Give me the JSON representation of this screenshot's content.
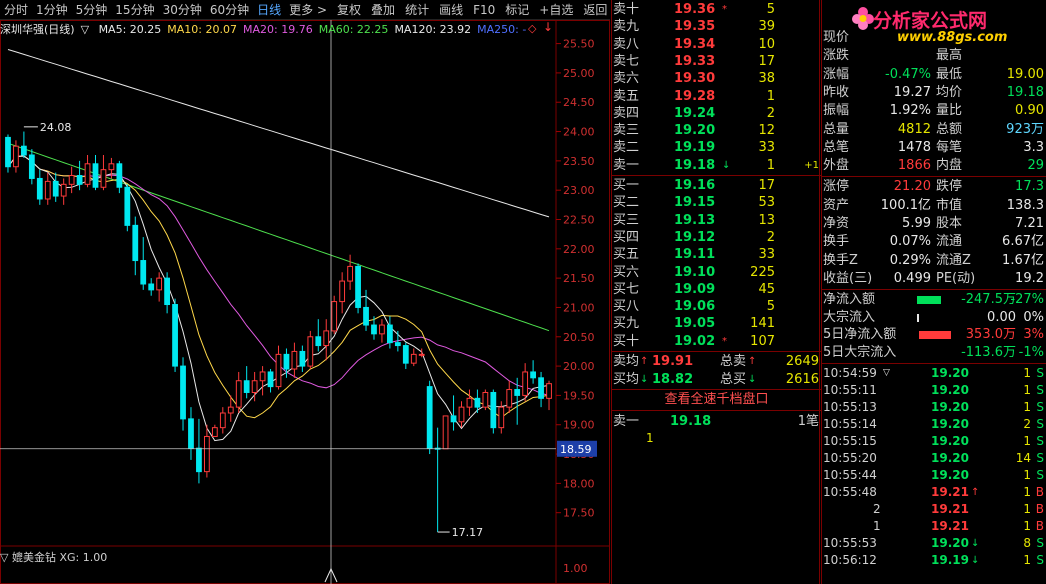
{
  "toolbar": {
    "periods": [
      "分时",
      "1分钟",
      "5分钟",
      "15分钟",
      "30分钟",
      "60分钟",
      "日线",
      "更多 >"
    ],
    "active": "日线",
    "actions": [
      "复权",
      "叠加",
      "统计",
      "画线",
      "F10",
      "标记",
      "+自选",
      "返回"
    ]
  },
  "chart": {
    "title": "深圳华强(日线)",
    "legend_marker": "▽",
    "ma": [
      {
        "label": "MA5: 20.25",
        "color": "#e8e8e8"
      },
      {
        "label": "MA10: 20.07",
        "color": "#ffd84a"
      },
      {
        "label": "MA20: 19.76",
        "color": "#e05ae0"
      },
      {
        "label": "MA60: 22.25",
        "color": "#4ee04e"
      },
      {
        "label": "MA120: 23.92",
        "color": "#e8e8e8"
      },
      {
        "label": "MA250: -",
        "color": "#4f6fff"
      }
    ],
    "marks": {
      "high_label": "24.08",
      "low_label": "17.17",
      "current_price": "18.59"
    },
    "sub_indicator": "▽ 媲美金钻  XG: 1.00",
    "sub_axis_label": "1.00",
    "up_color": "#ff3b3b",
    "down_color": "#00e8f0"
  },
  "chart_data": {
    "type": "candlestick",
    "ylim": [
      17.0,
      25.8
    ],
    "yticks": [
      "25.50",
      "25.00",
      "24.50",
      "24.00",
      "23.50",
      "23.00",
      "22.50",
      "22.00",
      "21.50",
      "21.00",
      "20.50",
      "20.00",
      "19.50",
      "19.00",
      "18.50",
      "18.00",
      "17.50"
    ],
    "candles": [
      [
        23.9,
        23.95,
        23.3,
        23.4
      ],
      [
        23.4,
        23.85,
        23.3,
        23.75
      ],
      [
        23.75,
        24.0,
        23.55,
        23.6
      ],
      [
        23.6,
        23.7,
        23.1,
        23.2
      ],
      [
        23.2,
        23.35,
        22.75,
        22.85
      ],
      [
        22.85,
        23.3,
        22.75,
        23.15
      ],
      [
        23.15,
        23.3,
        22.8,
        22.9
      ],
      [
        22.9,
        23.2,
        22.75,
        23.1
      ],
      [
        23.1,
        23.4,
        22.95,
        23.25
      ],
      [
        23.25,
        23.5,
        23.0,
        23.1
      ],
      [
        23.1,
        23.6,
        23.05,
        23.45
      ],
      [
        23.45,
        23.6,
        23.0,
        23.05
      ],
      [
        23.05,
        23.6,
        23.0,
        23.35
      ],
      [
        23.35,
        23.55,
        23.2,
        23.45
      ],
      [
        23.45,
        23.5,
        22.95,
        23.05
      ],
      [
        23.05,
        23.1,
        22.3,
        22.4
      ],
      [
        22.4,
        22.55,
        21.55,
        21.8
      ],
      [
        21.8,
        22.2,
        21.3,
        21.4
      ],
      [
        21.4,
        21.5,
        21.2,
        21.3
      ],
      [
        21.3,
        21.6,
        21.1,
        21.5
      ],
      [
        21.5,
        21.6,
        20.9,
        21.05
      ],
      [
        21.05,
        21.15,
        19.9,
        20.0
      ],
      [
        20.0,
        20.15,
        18.9,
        19.1
      ],
      [
        19.1,
        19.3,
        18.4,
        18.6
      ],
      [
        18.6,
        19.1,
        18.0,
        18.2
      ],
      [
        18.2,
        19.0,
        18.1,
        18.8
      ],
      [
        18.8,
        19.0,
        18.8,
        18.95
      ],
      [
        18.95,
        19.3,
        18.85,
        19.2
      ],
      [
        19.2,
        19.5,
        19.05,
        19.3
      ],
      [
        19.3,
        19.9,
        19.2,
        19.75
      ],
      [
        19.75,
        20.0,
        19.45,
        19.55
      ],
      [
        19.55,
        19.9,
        19.4,
        19.75
      ],
      [
        19.75,
        20.0,
        19.5,
        19.9
      ],
      [
        19.9,
        19.95,
        19.55,
        19.65
      ],
      [
        19.65,
        20.35,
        19.6,
        20.2
      ],
      [
        20.2,
        20.3,
        19.8,
        19.95
      ],
      [
        19.95,
        20.4,
        19.8,
        20.25
      ],
      [
        20.25,
        20.35,
        19.9,
        20.0
      ],
      [
        20.0,
        20.6,
        19.95,
        20.5
      ],
      [
        20.5,
        20.8,
        20.25,
        20.35
      ],
      [
        20.35,
        20.8,
        20.1,
        20.6
      ],
      [
        20.6,
        21.2,
        20.55,
        21.1
      ],
      [
        21.1,
        21.6,
        20.9,
        21.45
      ],
      [
        21.45,
        21.9,
        21.3,
        21.7
      ],
      [
        21.7,
        21.75,
        20.9,
        21.0
      ],
      [
        21.0,
        21.3,
        20.6,
        20.7
      ],
      [
        20.7,
        20.85,
        20.45,
        20.55
      ],
      [
        20.55,
        20.8,
        20.4,
        20.7
      ],
      [
        20.7,
        20.85,
        20.3,
        20.4
      ],
      [
        20.4,
        20.6,
        20.25,
        20.35
      ],
      [
        20.35,
        20.4,
        19.95,
        20.05
      ],
      [
        20.05,
        20.3,
        20.0,
        20.2
      ],
      [
        20.2,
        20.3,
        20.15,
        20.2
      ],
      [
        19.65,
        19.75,
        18.5,
        18.6
      ],
      [
        18.6,
        18.95,
        17.17,
        18.59
      ],
      [
        18.59,
        19.15,
        18.9,
        19.15
      ],
      [
        19.15,
        19.5,
        18.9,
        19.05
      ],
      [
        19.05,
        19.4,
        18.95,
        19.3
      ],
      [
        19.3,
        19.6,
        19.15,
        19.45
      ],
      [
        19.45,
        19.6,
        19.2,
        19.3
      ],
      [
        19.3,
        19.6,
        19.25,
        19.55
      ],
      [
        19.55,
        19.6,
        18.85,
        18.95
      ],
      [
        18.95,
        19.4,
        18.85,
        19.3
      ],
      [
        19.3,
        19.75,
        19.2,
        19.6
      ],
      [
        19.6,
        19.8,
        19.0,
        19.5
      ],
      [
        19.5,
        20.05,
        19.4,
        19.9
      ],
      [
        19.9,
        20.1,
        19.7,
        19.8
      ],
      [
        19.8,
        19.9,
        19.3,
        19.45
      ],
      [
        19.45,
        19.75,
        19.25,
        19.7
      ]
    ]
  },
  "orderbook": {
    "asks": [
      {
        "label": "卖十",
        "price": "19.36",
        "arrow": "*",
        "vol": "5"
      },
      {
        "label": "卖九",
        "price": "19.35",
        "arrow": "",
        "vol": "39"
      },
      {
        "label": "卖八",
        "price": "19.34",
        "arrow": "",
        "vol": "10"
      },
      {
        "label": "卖七",
        "price": "19.33",
        "arrow": "",
        "vol": "17"
      },
      {
        "label": "卖六",
        "price": "19.30",
        "arrow": "",
        "vol": "38"
      },
      {
        "label": "卖五",
        "price": "19.28",
        "arrow": "",
        "vol": "1"
      },
      {
        "label": "卖四",
        "price": "19.24",
        "arrow": "",
        "vol": "2"
      },
      {
        "label": "卖三",
        "price": "19.20",
        "arrow": "",
        "vol": "12"
      },
      {
        "label": "卖二",
        "price": "19.19",
        "arrow": "",
        "vol": "33"
      },
      {
        "label": "卖一",
        "price": "19.18",
        "arrow": "↓",
        "vol": "1",
        "chg": "+1"
      }
    ],
    "bids": [
      {
        "label": "买一",
        "price": "19.16",
        "arrow": "",
        "vol": "17"
      },
      {
        "label": "买二",
        "price": "19.15",
        "arrow": "",
        "vol": "53"
      },
      {
        "label": "买三",
        "price": "19.13",
        "arrow": "",
        "vol": "13"
      },
      {
        "label": "买四",
        "price": "19.12",
        "arrow": "",
        "vol": "2"
      },
      {
        "label": "买五",
        "price": "19.11",
        "arrow": "",
        "vol": "33"
      },
      {
        "label": "买六",
        "price": "19.10",
        "arrow": "",
        "vol": "225"
      },
      {
        "label": "买七",
        "price": "19.09",
        "arrow": "",
        "vol": "45"
      },
      {
        "label": "买八",
        "price": "19.06",
        "arrow": "",
        "vol": "5"
      },
      {
        "label": "买九",
        "price": "19.05",
        "arrow": "",
        "vol": "141"
      },
      {
        "label": "买十",
        "price": "19.02",
        "arrow": "*",
        "vol": "107"
      }
    ],
    "summary": {
      "ask_avg_label": "卖均",
      "ask_avg": "19.91",
      "ask_total_label": "总卖",
      "ask_total": "2649",
      "bid_avg_label": "买均",
      "bid_avg": "18.82",
      "bid_total_label": "总买",
      "bid_total": "2616"
    },
    "view_button": "查看全速千档盘口",
    "ask1_label": "卖一",
    "ask1_price": "19.18",
    "ask1_count": "1笔",
    "ask1_detail": "1"
  },
  "quote": {
    "logo_title": "分析家公式网",
    "logo_url": "www.88gs.com",
    "rows": [
      {
        "l1": "现价",
        "v1": "",
        "l2": "",
        "v2": "",
        "c1": "white",
        "c2": "white"
      },
      {
        "l1": "涨跌",
        "v1": "",
        "l2": "最高",
        "v2": "",
        "c1": "green",
        "c2": "red"
      },
      {
        "l1": "涨幅",
        "v1": "-0.47%",
        "l2": "最低",
        "v2": "19.00",
        "c1": "green",
        "c2": "yellow"
      },
      {
        "l1": "昨收",
        "v1": "19.27",
        "l2": "均价",
        "v2": "19.18",
        "c1": "white",
        "c2": "green"
      },
      {
        "l1": "振幅",
        "v1": "1.92%",
        "l2": "量比",
        "v2": "0.90",
        "c1": "white",
        "c2": "yellow"
      },
      {
        "l1": "总量",
        "v1": "4812",
        "l2": "总额",
        "v2": "923万",
        "c1": "yellow",
        "c2": "cyan"
      },
      {
        "l1": "总笔",
        "v1": "1478",
        "l2": "每笔",
        "v2": "3.3",
        "c1": "white",
        "c2": "white"
      },
      {
        "l1": "外盘",
        "v1": "1866",
        "l2": "内盘",
        "v2": "29",
        "c1": "red",
        "c2": "green"
      },
      {
        "l1": "涨停",
        "v1": "21.20",
        "l2": "跌停",
        "v2": "17.3",
        "c1": "red",
        "c2": "green"
      },
      {
        "l1": "资产",
        "v1": "100.1亿",
        "l2": "市值",
        "v2": "138.3",
        "c1": "white",
        "c2": "white"
      },
      {
        "l1": "净资",
        "v1": "5.99",
        "l2": "股本",
        "v2": "7.21",
        "c1": "white",
        "c2": "white"
      },
      {
        "l1": "换手",
        "v1": "0.07%",
        "l2": "流通",
        "v2": "6.67亿",
        "c1": "white",
        "c2": "white"
      },
      {
        "l1": "换手Z",
        "v1": "0.29%",
        "l2": "流通Z",
        "v2": "1.67亿",
        "c1": "white",
        "c2": "white"
      },
      {
        "l1": "收益(三)",
        "v1": "0.499",
        "l2": "PE(动)",
        "v2": "19.2",
        "c1": "white",
        "c2": "white"
      }
    ],
    "flows": [
      {
        "label": "净流入额",
        "value": "-247.5万",
        "pct": "-27%",
        "bar": -0.6,
        "color": "green"
      },
      {
        "label": "大宗流入",
        "value": "0.00",
        "pct": "0%",
        "bar": 0.02,
        "color": "white"
      },
      {
        "label": "5日净流入额",
        "value": "353.0万",
        "pct": "3%",
        "bar": 0.8,
        "color": "red"
      },
      {
        "label": "5日大宗流入",
        "value": "-113.6万",
        "pct": "-1%",
        "bar": 0,
        "color": "green"
      }
    ],
    "ticks": [
      {
        "time": "10:54:59",
        "marker": "▽",
        "price": "19.20",
        "arrow": "",
        "vol": "1",
        "side": "S",
        "pc": "green",
        "sc": "green"
      },
      {
        "time": "10:55:11",
        "marker": "",
        "price": "19.20",
        "arrow": "",
        "vol": "1",
        "side": "S",
        "pc": "green",
        "sc": "green"
      },
      {
        "time": "10:55:13",
        "marker": "",
        "price": "19.20",
        "arrow": "",
        "vol": "1",
        "side": "S",
        "pc": "green",
        "sc": "green"
      },
      {
        "time": "10:55:14",
        "marker": "",
        "price": "19.20",
        "arrow": "",
        "vol": "2",
        "side": "S",
        "pc": "green",
        "sc": "green"
      },
      {
        "time": "10:55:15",
        "marker": "",
        "price": "19.20",
        "arrow": "",
        "vol": "1",
        "side": "S",
        "pc": "green",
        "sc": "green"
      },
      {
        "time": "10:55:20",
        "marker": "",
        "price": "19.20",
        "arrow": "",
        "vol": "14",
        "side": "S",
        "pc": "green",
        "sc": "green"
      },
      {
        "time": "10:55:44",
        "marker": "",
        "price": "19.20",
        "arrow": "",
        "vol": "1",
        "side": "S",
        "pc": "green",
        "sc": "green"
      },
      {
        "time": "10:55:48",
        "marker": "",
        "price": "19.21",
        "arrow": "↑",
        "vol": "1",
        "side": "B",
        "pc": "red",
        "sc": "red"
      },
      {
        "time": "2",
        "marker": "",
        "price": "19.21",
        "arrow": "",
        "vol": "1",
        "side": "B",
        "pc": "red",
        "sc": "red"
      },
      {
        "time": "1",
        "marker": "",
        "price": "19.21",
        "arrow": "",
        "vol": "1",
        "side": "B",
        "pc": "red",
        "sc": "red"
      },
      {
        "time": "10:55:53",
        "marker": "",
        "price": "19.20",
        "arrow": "↓",
        "vol": "8",
        "side": "S",
        "pc": "green",
        "sc": "green"
      },
      {
        "time": "10:56:12",
        "marker": "",
        "price": "19.19",
        "arrow": "↓",
        "vol": "1",
        "side": "S",
        "pc": "green",
        "sc": "green"
      }
    ]
  }
}
